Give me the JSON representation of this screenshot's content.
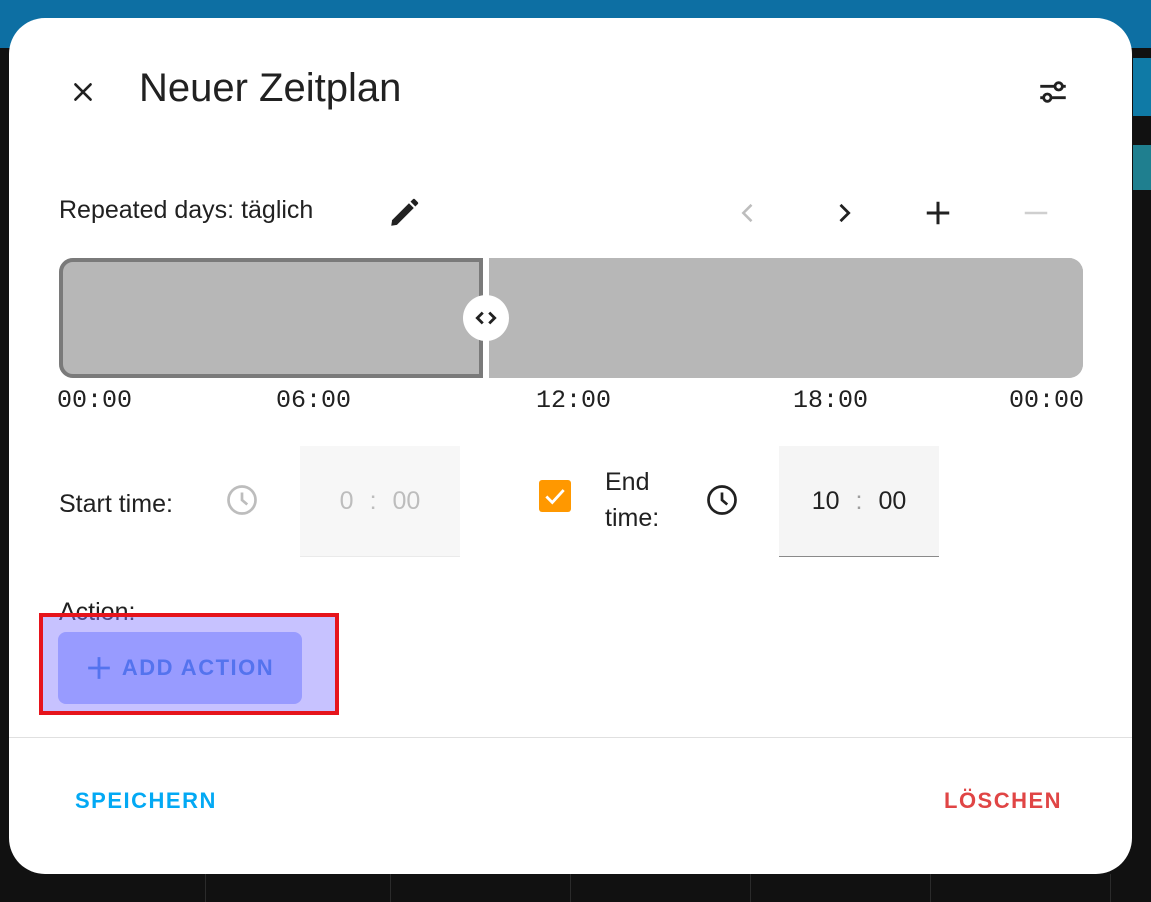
{
  "dialog": {
    "title": "Neuer Zeitplan"
  },
  "schedule": {
    "days_label": "Repeated days: täglich",
    "timeline_ticks": [
      "00:00",
      "06:00",
      "12:00",
      "18:00",
      "00:00"
    ],
    "start_time": {
      "label": "Start time:",
      "hours": "0",
      "minutes": "00",
      "separator": ":"
    },
    "end_time": {
      "label_line1": "End",
      "label_line2": "time:",
      "hours": "10",
      "minutes": "00",
      "separator": ":",
      "enabled": true
    }
  },
  "action": {
    "label": "Action:",
    "add_label": "ADD ACTION"
  },
  "footer": {
    "save_label": "SPEICHERN",
    "delete_label": "LÖSCHEN"
  },
  "colors": {
    "accent_blue": "#03a9f4",
    "delete_red": "#e04545",
    "checkbox_orange": "#ff9800",
    "add_action_bg": "#a9b8ff",
    "add_action_text": "#2e6fe0",
    "timeline_slot": "#b7b7b7",
    "highlight_border": "#e6141c"
  },
  "icons": {
    "close": "close-icon",
    "settings": "tune-icon",
    "edit": "pencil-icon",
    "prev": "chevron-left-icon",
    "next": "chevron-right-icon",
    "add_slot": "plus-icon",
    "remove_slot": "minus-icon",
    "handle": "code-arrows-icon",
    "clock": "clock-icon",
    "check": "check-icon"
  }
}
